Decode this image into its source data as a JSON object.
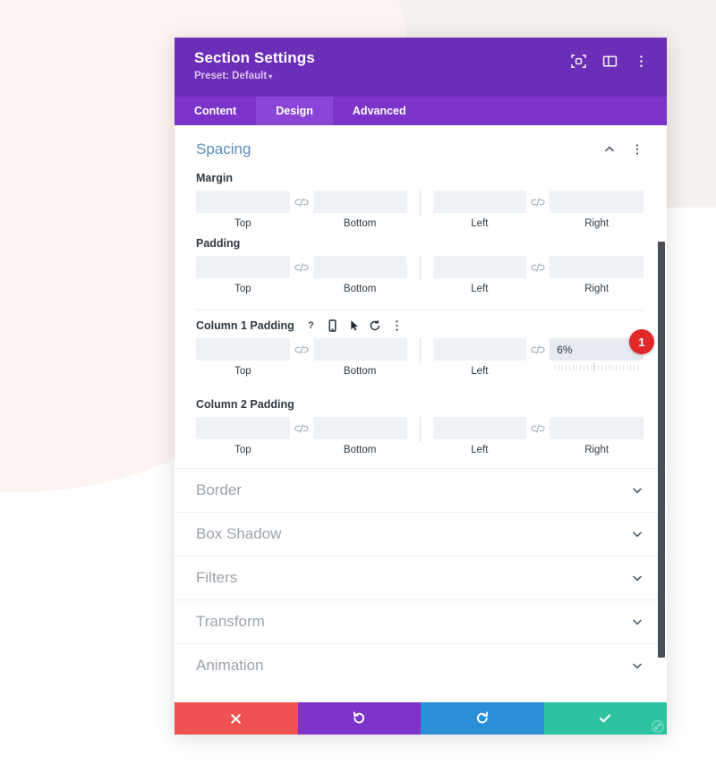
{
  "header": {
    "title": "Section Settings",
    "preset_label": "Preset: Default",
    "caret": "▾",
    "icons": [
      {
        "name": "focus-target-icon"
      },
      {
        "name": "split-layout-icon"
      },
      {
        "name": "more-vertical-icon"
      }
    ]
  },
  "tabs": [
    {
      "label": "Content",
      "active": false
    },
    {
      "label": "Design",
      "active": true
    },
    {
      "label": "Advanced",
      "active": false
    }
  ],
  "panel": {
    "title": "Spacing",
    "collapse_icon": "chevron-up-icon",
    "more_icon": "more-vertical-icon"
  },
  "groups": [
    {
      "label": "Margin",
      "has_icons": false,
      "fields": [
        {
          "name": "top",
          "caption": "Top",
          "value": "",
          "focused": false
        },
        {
          "name": "bottom",
          "caption": "Bottom",
          "value": "",
          "focused": false
        },
        {
          "name": "left",
          "caption": "Left",
          "value": "",
          "focused": false
        },
        {
          "name": "right",
          "caption": "Right",
          "value": "",
          "focused": false
        }
      ]
    },
    {
      "label": "Padding",
      "has_icons": false,
      "fields": [
        {
          "name": "top",
          "caption": "Top",
          "value": "",
          "focused": false
        },
        {
          "name": "bottom",
          "caption": "Bottom",
          "value": "",
          "focused": false
        },
        {
          "name": "left",
          "caption": "Left",
          "value": "",
          "focused": false
        },
        {
          "name": "right",
          "caption": "Right",
          "value": "",
          "focused": false
        }
      ]
    },
    {
      "label": "Column 1 Padding",
      "has_icons": true,
      "icons": [
        {
          "name": "help-icon",
          "glyph": "?"
        },
        {
          "name": "responsive-icon",
          "glyph": ""
        },
        {
          "name": "hover-cursor-icon",
          "glyph": ""
        },
        {
          "name": "reset-icon",
          "glyph": ""
        },
        {
          "name": "more-vertical-icon",
          "glyph": ""
        }
      ],
      "fields": [
        {
          "name": "top",
          "caption": "Top",
          "value": "",
          "focused": false
        },
        {
          "name": "bottom",
          "caption": "Bottom",
          "value": "",
          "focused": false
        },
        {
          "name": "left",
          "caption": "Left",
          "value": "",
          "focused": false
        },
        {
          "name": "right",
          "caption": "",
          "value": "6%",
          "focused": true
        }
      ],
      "badge": "1"
    },
    {
      "label": "Column 2 Padding",
      "has_icons": false,
      "fields": [
        {
          "name": "top",
          "caption": "Top",
          "value": "",
          "focused": false
        },
        {
          "name": "bottom",
          "caption": "Bottom",
          "value": "",
          "focused": false
        },
        {
          "name": "left",
          "caption": "Left",
          "value": "",
          "focused": false
        },
        {
          "name": "right",
          "caption": "Right",
          "value": "",
          "focused": false
        }
      ]
    }
  ],
  "sections": [
    {
      "label": "Border"
    },
    {
      "label": "Box Shadow"
    },
    {
      "label": "Filters"
    },
    {
      "label": "Transform"
    },
    {
      "label": "Animation"
    }
  ],
  "footer": {
    "buttons": [
      {
        "name": "cancel-button",
        "icon": "close-icon",
        "color": "#ef5350"
      },
      {
        "name": "undo-button",
        "icon": "undo-icon",
        "color": "#7b33c9"
      },
      {
        "name": "redo-button",
        "icon": "redo-icon",
        "color": "#2b8fd8"
      },
      {
        "name": "save-button",
        "icon": "checkmark-icon",
        "color": "#2dc3a0"
      }
    ],
    "resize_handle": "resize-handle-icon"
  },
  "colors": {
    "header_purple": "#6c2eb7",
    "tab_purple": "#7b33c9",
    "tab_active_purple": "#8b45d6",
    "panel_title_blue": "#5b8ab5",
    "badge_red": "#e02828",
    "field_bg": "#eef1f6"
  }
}
